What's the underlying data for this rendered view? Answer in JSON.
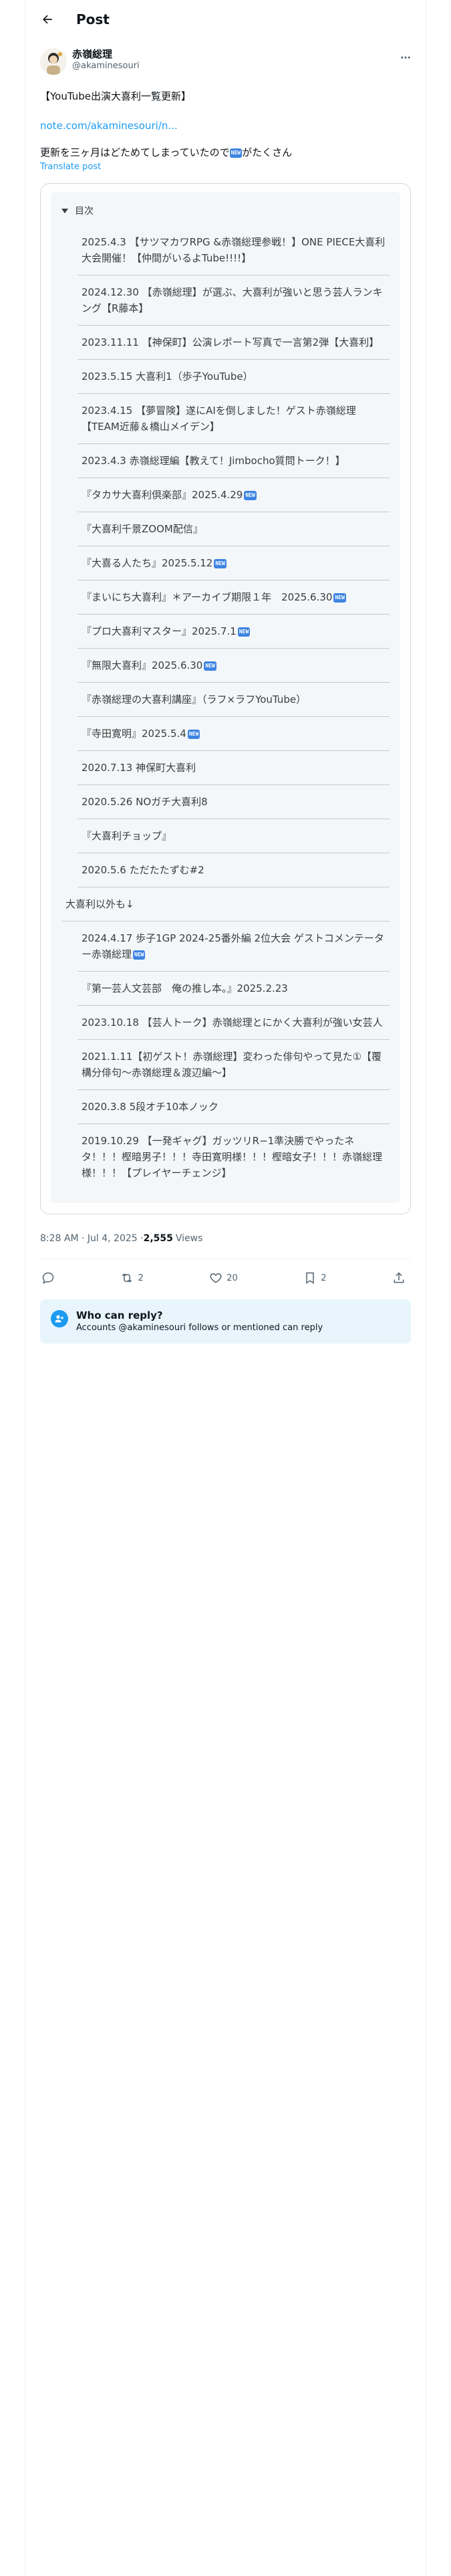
{
  "topbar": {
    "title": "Post"
  },
  "author": {
    "display_name": "赤嶺総理",
    "handle": "@akaminesouri"
  },
  "post": {
    "headline": "【YouTube出演大喜利一覧更新】",
    "link": "note.com/akaminesouri/n...",
    "line_before_badge": "更新を三ヶ月はどためてしまっていたので",
    "line_after_badge": "がたくさん",
    "translate": "Translate post",
    "new_badge": "NEW"
  },
  "toc": {
    "title": "目次",
    "items": [
      {
        "level": 1,
        "text": "2025.4.3 【サツマカワRPG &赤嶺総理参戦！】ONE PIECE大喜利大会開催！【仲間がいるよTube!!!!】",
        "new": false
      },
      {
        "level": 1,
        "text": "2024.12.30 【赤嶺総理】が選ぶ、大喜利が強いと思う芸人ランキング【R藤本】",
        "new": false
      },
      {
        "level": 1,
        "text": "2023.11.11 【神保町】公演レポート写真で一言第2弾【大喜利】",
        "new": false
      },
      {
        "level": 1,
        "text": "2023.5.15 大喜利1（歩子YouTube）",
        "new": false
      },
      {
        "level": 1,
        "text": "2023.4.15 【夢冒険】遂にAIを倒しました！ゲスト赤嶺総理【TEAM近藤＆橋山メイデン】",
        "new": false
      },
      {
        "level": 1,
        "text": "2023.4.3 赤嶺総理編【教えて！Jimbocho質問トーク！】",
        "new": false
      },
      {
        "level": 1,
        "text": "『タカサ大喜利倶楽部』2025.4.29",
        "new": true
      },
      {
        "level": 1,
        "text": "『大喜利千景ZOOM配信』",
        "new": false
      },
      {
        "level": 1,
        "text": "『大喜る人たち』2025.5.12",
        "new": true
      },
      {
        "level": 1,
        "text": "『まいにち大喜利』＊アーカイブ期限１年　2025.6.30",
        "new": true
      },
      {
        "level": 1,
        "text": "『プロ大喜利マスター』2025.7.1",
        "new": true
      },
      {
        "level": 1,
        "text": "『無限大喜利』2025.6.30",
        "new": true
      },
      {
        "level": 1,
        "text": "『赤嶺総理の大喜利講座』（ラフ×ラフYouTube）",
        "new": false
      },
      {
        "level": 1,
        "text": "『寺田寛明』2025.5.4",
        "new": true
      },
      {
        "level": 1,
        "text": "2020.7.13 神保町大喜利",
        "new": false
      },
      {
        "level": 1,
        "text": "2020.5.26 NOガチ大喜利8",
        "new": false
      },
      {
        "level": 1,
        "text": "『大喜利チョップ』",
        "new": false
      },
      {
        "level": 1,
        "text": "2020.5.6 ただたたずむ#2",
        "new": false
      },
      {
        "level": 0,
        "text": "大喜利以外も↓",
        "new": false
      },
      {
        "level": 1,
        "text": "2024.4.17 歩子1GP 2024-25番外編 2位大会 ゲストコメンテーター赤嶺総理",
        "new": true
      },
      {
        "level": 1,
        "text": "『第一芸人文芸部　俺の推し本。』2025.2.23",
        "new": false
      },
      {
        "level": 1,
        "text": "2023.10.18 【芸人トーク】赤嶺総理とにかく大喜利が強い女芸人",
        "new": false
      },
      {
        "level": 1,
        "text": "2021.1.11【初ゲスト！赤嶺総理】変わった俳句やって見た①【覆構分俳句〜赤嶺総理＆渡辺編〜】",
        "new": false
      },
      {
        "level": 1,
        "text": "2020.3.8 5段オチ10本ノック",
        "new": false
      },
      {
        "level": 1,
        "text": "2019.10.29 【一発ギャグ】ガッツリR−1準決勝でやったネタ！！！樫暗男子！！！寺田寛明様！！！樫暗女子！！！赤嶺総理様！！！【プレイヤーチェンジ】",
        "new": false
      }
    ]
  },
  "meta": {
    "time": "8:28 AM · Jul 4, 2025 · ",
    "views_count": "2,555",
    "views_label": "Views"
  },
  "actions": {
    "reposts": "2",
    "likes": "20",
    "bookmarks": "2"
  },
  "reply_box": {
    "title": "Who can reply?",
    "subtitle": "Accounts @akaminesouri follows or mentioned can reply"
  }
}
